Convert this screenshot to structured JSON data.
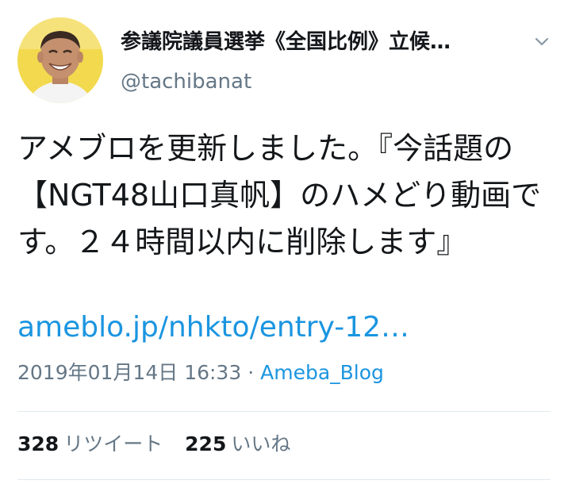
{
  "tweet": {
    "display_name": "参議院議員選挙《全国比例》立候…",
    "handle": "@tachibanat",
    "text": "アメブロを更新しました。『今話題の【NGT48山口真帆】のハメどり動画です。２４時間以内に削除します』",
    "link": "ameblo.jp/nhkto/entry-12…",
    "timestamp": "2019年01月14日 16:33",
    "separator": "·",
    "source": "Ameba_Blog",
    "retweets": {
      "count": "328",
      "label": "リツイート"
    },
    "likes": {
      "count": "225",
      "label": "いいね"
    }
  },
  "colors": {
    "text": "#14171a",
    "secondary": "#657786",
    "link": "#1b95e0",
    "divider": "#e1e8ed",
    "avatar_bg": "#f2d94e"
  },
  "icons": {
    "caret": "chevron-down-icon",
    "avatar": "profile-photo"
  }
}
